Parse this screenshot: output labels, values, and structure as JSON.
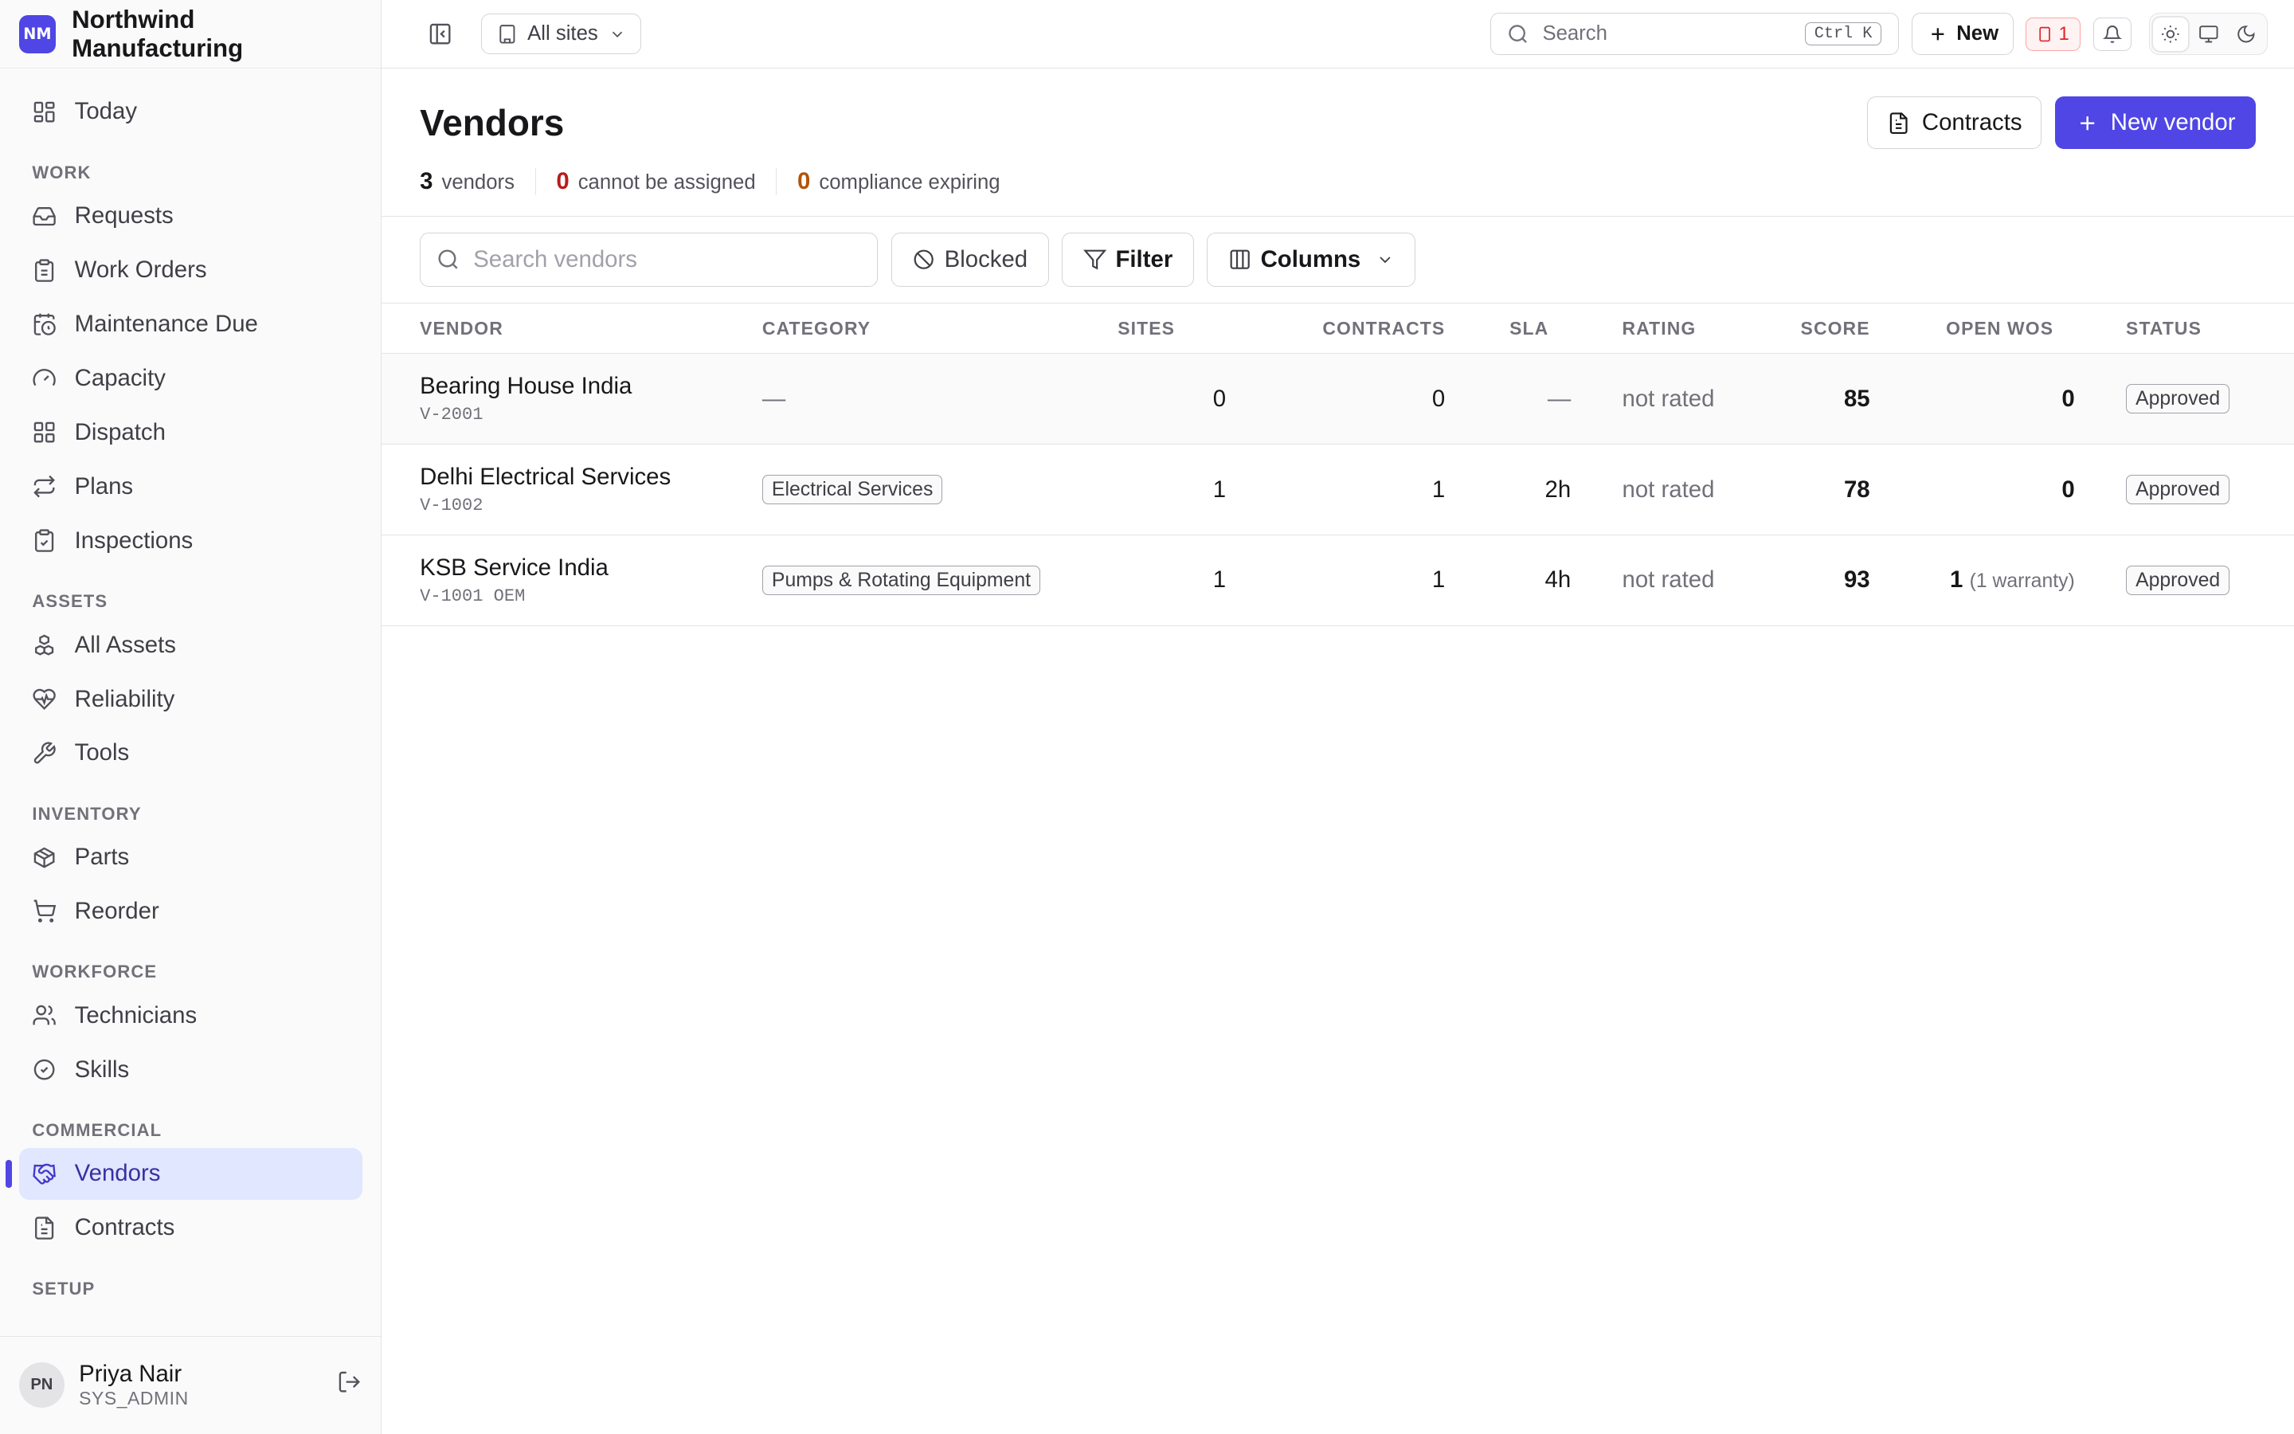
{
  "brand": {
    "initials": "NM",
    "name": "Northwind Manufacturing"
  },
  "sidebar": {
    "today": "Today",
    "sections": {
      "work": "WORK",
      "assets": "ASSETS",
      "inventory": "INVENTORY",
      "workforce": "WORKFORCE",
      "commercial": "COMMERCIAL",
      "setup": "SETUP"
    },
    "items": {
      "requests": "Requests",
      "work_orders": "Work Orders",
      "maintenance_due": "Maintenance Due",
      "capacity": "Capacity",
      "dispatch": "Dispatch",
      "plans": "Plans",
      "inspections": "Inspections",
      "all_assets": "All Assets",
      "reliability": "Reliability",
      "tools": "Tools",
      "parts": "Parts",
      "reorder": "Reorder",
      "technicians": "Technicians",
      "skills": "Skills",
      "vendors": "Vendors",
      "contracts": "Contracts"
    },
    "user": {
      "initials": "PN",
      "name": "Priya Nair",
      "role": "SYS_ADMIN"
    }
  },
  "topbar": {
    "site_select": "All sites",
    "search_placeholder": "Search",
    "shortcut": "Ctrl K",
    "new_label": "New",
    "alert_count": "1"
  },
  "page": {
    "title": "Vendors",
    "contracts_button": "Contracts",
    "new_vendor_button": "New vendor",
    "stats": {
      "vendors_count": "3",
      "vendors_label": "vendors",
      "unassignable_count": "0",
      "unassignable_label": "cannot be assigned",
      "expiring_count": "0",
      "expiring_label": "compliance expiring"
    }
  },
  "toolbar": {
    "search_placeholder": "Search vendors",
    "blocked": "Blocked",
    "filter": "Filter",
    "columns": "Columns"
  },
  "table": {
    "headers": {
      "vendor": "VENDOR",
      "category": "CATEGORY",
      "sites": "SITES",
      "contracts": "CONTRACTS",
      "sla": "SLA",
      "rating": "RATING",
      "score": "SCORE",
      "open_wos": "OPEN WOS",
      "status": "STATUS"
    },
    "rows": [
      {
        "name": "Bearing House India",
        "code": "V-2001",
        "category": "—",
        "sites": "0",
        "contracts": "0",
        "sla": "—",
        "rating": "not rated",
        "score": "85",
        "open_wos": "0",
        "open_wos_note": "",
        "status": "Approved"
      },
      {
        "name": "Delhi Electrical Services",
        "code": "V-1002",
        "category": "Electrical Services",
        "sites": "1",
        "contracts": "1",
        "sla": "2h",
        "rating": "not rated",
        "score": "78",
        "open_wos": "0",
        "open_wos_note": "",
        "status": "Approved"
      },
      {
        "name": "KSB Service India",
        "code": "V-1001 OEM",
        "category": "Pumps & Rotating Equipment",
        "sites": "1",
        "contracts": "1",
        "sla": "4h",
        "rating": "not rated",
        "score": "93",
        "open_wos": "1",
        "open_wos_note": "(1 warranty)",
        "status": "Approved"
      }
    ]
  }
}
